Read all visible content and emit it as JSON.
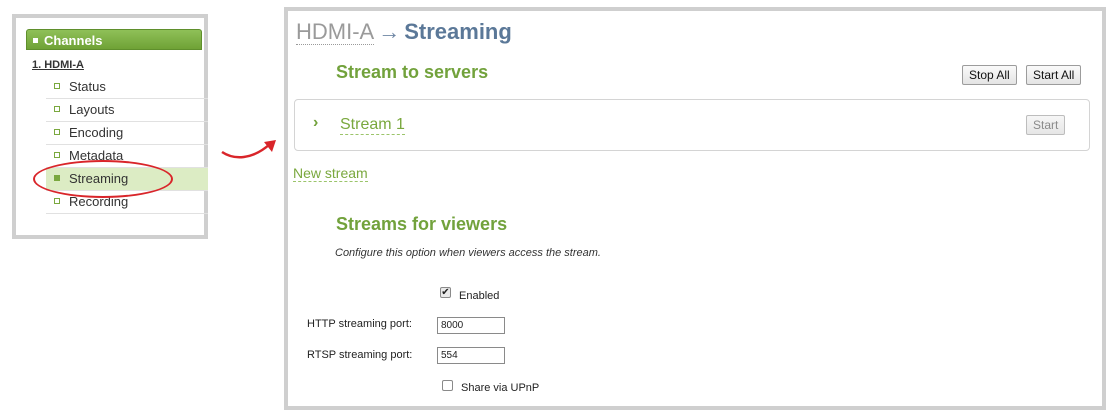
{
  "sidebar": {
    "header": "Channels",
    "channel_name": "1. HDMI-A",
    "items": [
      {
        "label": "Status"
      },
      {
        "label": "Layouts"
      },
      {
        "label": "Encoding"
      },
      {
        "label": "Metadata"
      },
      {
        "label": "Streaming",
        "active": true
      },
      {
        "label": "Recording"
      }
    ]
  },
  "breadcrumb": {
    "root": "HDMI-A",
    "separator": "→",
    "current": "Streaming"
  },
  "stream_to_servers": {
    "title": "Stream to servers",
    "stop_all_label": "Stop All",
    "start_all_label": "Start All",
    "stream": {
      "name": "Stream 1",
      "start_label": "Start"
    },
    "new_stream_label": "New stream"
  },
  "streams_for_viewers": {
    "title": "Streams for viewers",
    "description": "Configure this option when viewers access the stream.",
    "enabled_label": "Enabled",
    "enabled": true,
    "http_port_label": "HTTP streaming port:",
    "http_port_value": "8000",
    "rtsp_port_label": "RTSP streaming port:",
    "rtsp_port_value": "554",
    "upnp_label": "Share via UPnP",
    "upnp": false
  },
  "colors": {
    "accent_green": "#72a23c",
    "title_blue": "#5b7898",
    "callout_red": "#d9252a"
  }
}
